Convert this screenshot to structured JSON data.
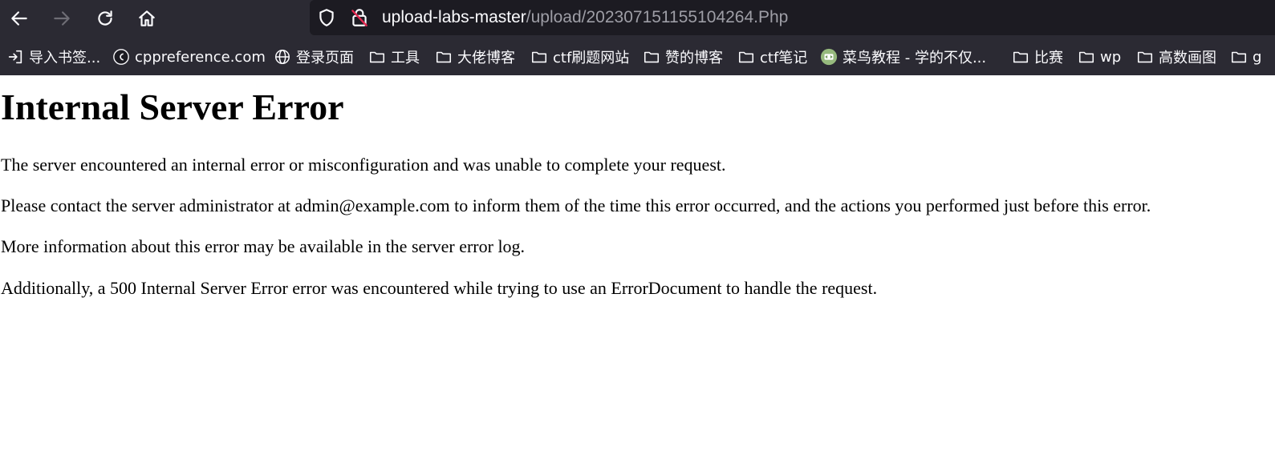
{
  "browser": {
    "url_host": "upload-labs-master",
    "url_path": "/upload/202307151155104264.Php",
    "bookmarks": [
      {
        "label": "导入书签...",
        "icon": "import-icon"
      },
      {
        "label": "cppreference.com",
        "icon": "site-favicon"
      },
      {
        "label": "登录页面",
        "icon": "globe-icon"
      },
      {
        "label": "工具",
        "icon": "folder-icon"
      },
      {
        "label": "大佬博客",
        "icon": "folder-icon"
      },
      {
        "label": "ctf刷题网站",
        "icon": "folder-icon"
      },
      {
        "label": "赞的博客",
        "icon": "folder-icon"
      },
      {
        "label": "ctf笔记",
        "icon": "folder-icon"
      },
      {
        "label": "菜鸟教程 - 学的不仅...",
        "icon": "runoob-favicon"
      },
      {
        "label": "比赛",
        "icon": "folder-icon"
      },
      {
        "label": "wp",
        "icon": "folder-icon"
      },
      {
        "label": "高数画图",
        "icon": "folder-icon"
      },
      {
        "label": "g",
        "icon": "folder-icon"
      }
    ]
  },
  "page": {
    "title": "Internal Server Error",
    "paragraphs": [
      "The server encountered an internal error or misconfiguration and was unable to complete your request.",
      "Please contact the server administrator at admin@example.com to inform them of the time this error occurred, and the actions you performed just before this error.",
      "More information about this error may be available in the server error log.",
      "Additionally, a 500 Internal Server Error error was encountered while trying to use an ErrorDocument to handle the request."
    ]
  },
  "colors": {
    "chrome_bg": "#2b2a33",
    "urlbar_bg": "#1c1b22",
    "chrome_text": "#fbfbfe",
    "url_path_text": "#9e9ea6",
    "page_bg": "#ffffff",
    "page_text": "#000000"
  }
}
